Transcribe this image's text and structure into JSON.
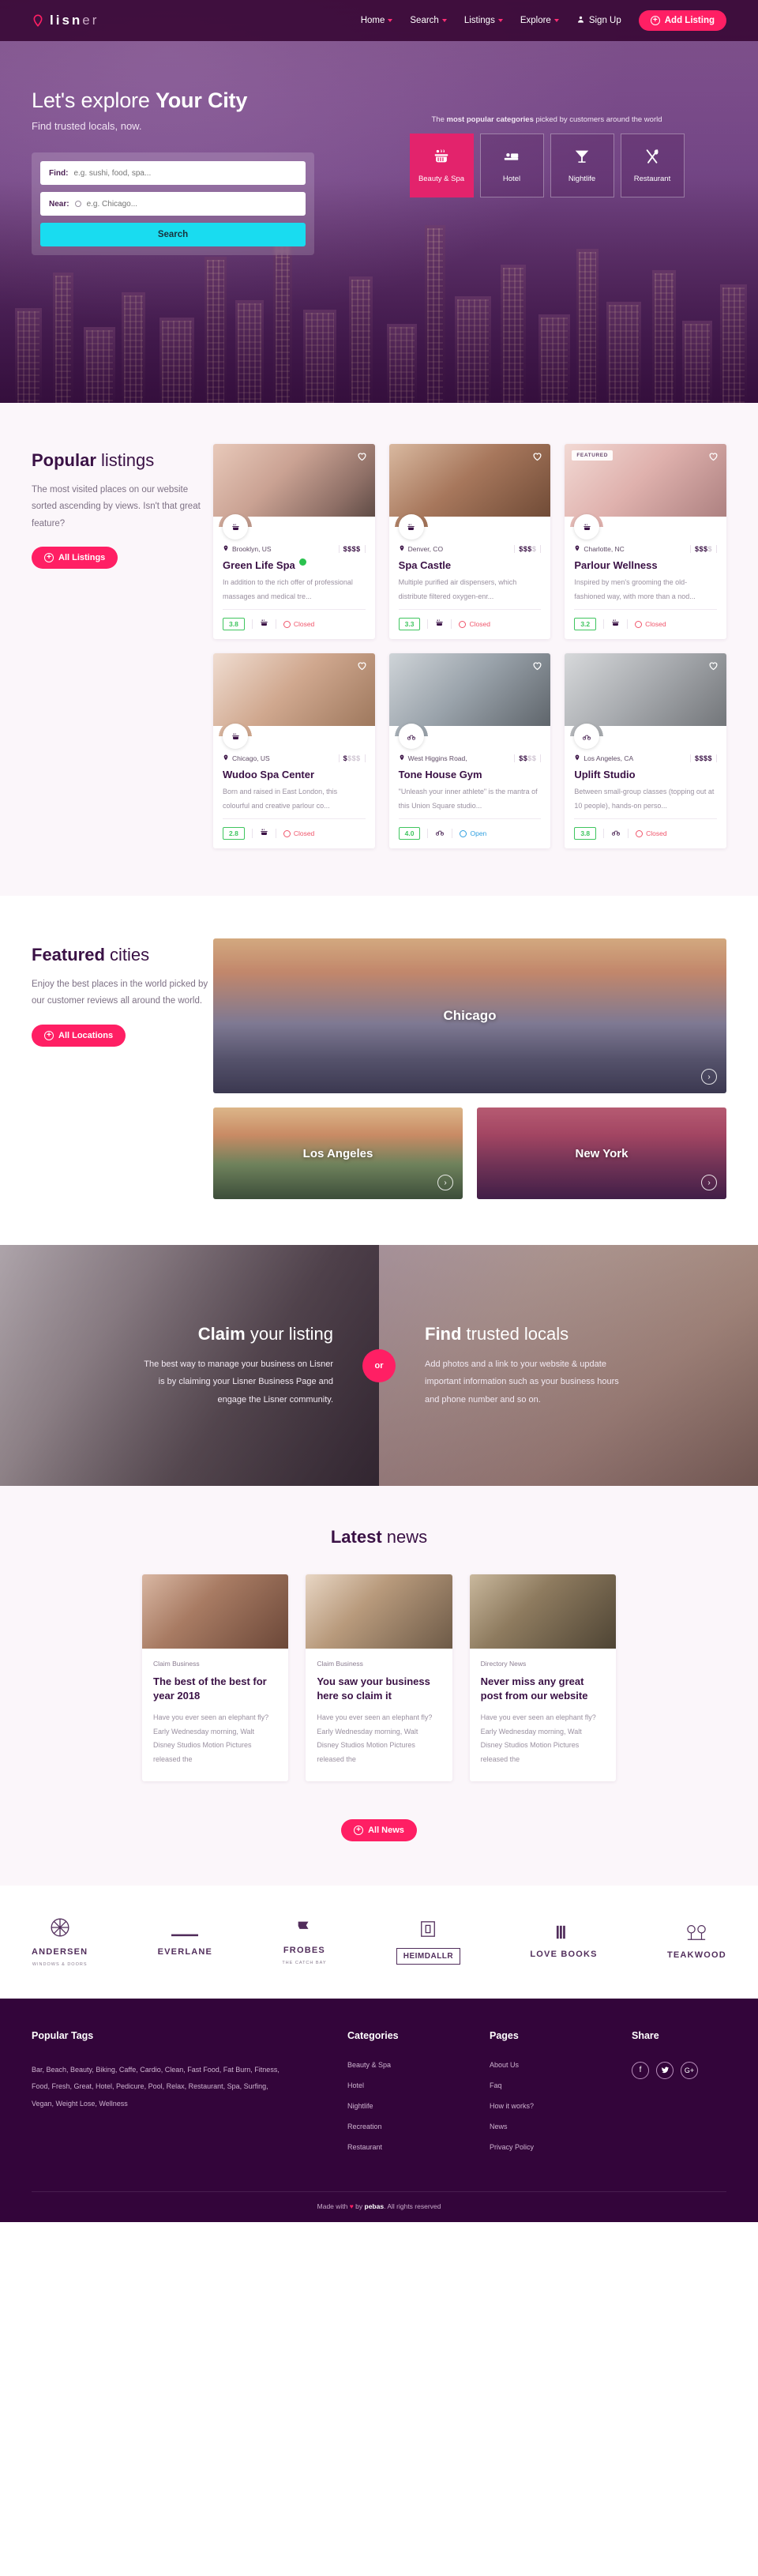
{
  "brand": {
    "name_bold": "lisn",
    "name_light": "er",
    "mark": "location-drop-icon"
  },
  "nav": {
    "items": [
      {
        "label": "Home",
        "has_dropdown": true
      },
      {
        "label": "Search",
        "has_dropdown": true
      },
      {
        "label": "Listings",
        "has_dropdown": true
      },
      {
        "label": "Explore",
        "has_dropdown": true
      }
    ],
    "signup_label": "Sign Up",
    "add_listing_label": "Add Listing"
  },
  "hero": {
    "title_light": "Let's explore ",
    "title_bold": "Your City",
    "subtitle": "Find trusted locals, now.",
    "find_label": "Find:",
    "find_placeholder": "e.g. sushi, food, spa...",
    "near_label": "Near:",
    "near_placeholder": "e.g. Chicago...",
    "search_button": "Search",
    "categories_caption_pre": "The ",
    "categories_caption_bold": "most popular categories",
    "categories_caption_post": " picked by customers around the world",
    "categories": [
      {
        "label": "Beauty & Spa",
        "icon": "spa-icon",
        "active": true
      },
      {
        "label": "Hotel",
        "icon": "bed-icon",
        "active": false
      },
      {
        "label": "Nightlife",
        "icon": "cocktail-icon",
        "active": false
      },
      {
        "label": "Restaurant",
        "icon": "fork-spoon-icon",
        "active": false
      }
    ]
  },
  "popular": {
    "title_bold": "Popular",
    "title_light": " listings",
    "description": "The most visited places on our website sorted ascending by views. Isn't that great feature?",
    "button": "All Listings",
    "listings": [
      {
        "location": "Brooklyn, US",
        "price": "$$$$",
        "price_filled": 4,
        "name": "Green Life Spa",
        "verified": true,
        "featured": false,
        "text": "In addition to the rich offer of professional massages and medical tre...",
        "rating": "3.8",
        "status": "Closed",
        "open": false,
        "type_icon": "spa-icon"
      },
      {
        "location": "Denver, CO",
        "price": "$$$$",
        "price_filled": 3,
        "name": "Spa Castle",
        "verified": false,
        "featured": false,
        "text": "Multiple purified air dispensers, which distribute filtered oxygen-enr...",
        "rating": "3.3",
        "status": "Closed",
        "open": false,
        "type_icon": "spa-icon"
      },
      {
        "location": "Charlotte, NC",
        "price": "$$$$",
        "price_filled": 3,
        "name": "Parlour Wellness",
        "verified": false,
        "featured": true,
        "text": "Inspired by men's grooming the old-fashioned way, with more than a nod...",
        "rating": "3.2",
        "status": "Closed",
        "open": false,
        "type_icon": "spa-icon"
      },
      {
        "location": "Chicago, US",
        "price": "$$$$",
        "price_filled": 1,
        "name": "Wudoo Spa Center",
        "verified": false,
        "featured": false,
        "text": "Born and raised in East London, this colourful and creative parlour co...",
        "rating": "2.8",
        "status": "Closed",
        "open": false,
        "type_icon": "spa-icon"
      },
      {
        "location": "West Higgins Road,",
        "price": "$$$$",
        "price_filled": 2,
        "name": "Tone House Gym",
        "verified": false,
        "featured": false,
        "text": "\"Unleash your inner athlete\" is the mantra of this Union Square studio...",
        "rating": "4.0",
        "status": "Open",
        "open": true,
        "type_icon": "bike-icon"
      },
      {
        "location": "Los Angeles, CA",
        "price": "$$$$",
        "price_filled": 4,
        "name": "Uplift Studio",
        "verified": false,
        "featured": false,
        "text": "Between small-group classes (topping out at 10 people), hands-on perso...",
        "rating": "3.8",
        "status": "Closed",
        "open": false,
        "type_icon": "bike-icon"
      }
    ]
  },
  "cities": {
    "title_bold": "Featured",
    "title_light": " cities",
    "description": "Enjoy the best places in the world picked by our customer reviews all around the world.",
    "button": "All Locations",
    "big": {
      "name": "Chicago",
      "arrow": "arrow-right-icon"
    },
    "small": [
      {
        "name": "Los Angeles",
        "arrow": "arrow-right-icon"
      },
      {
        "name": "New York",
        "arrow": "arrow-right-icon"
      }
    ]
  },
  "claim": {
    "or_label": "or",
    "left": {
      "title_bold": "Claim",
      "title_light": " your listing",
      "text": "The best way to manage your business on Lisner is by claiming your Lisner Business Page and engage the Lisner community."
    },
    "right": {
      "title_bold": "Find",
      "title_light": " trusted locals",
      "text": "Add photos and a link to your website & update important information such as your business hours and phone number and so on."
    }
  },
  "news": {
    "title_bold": "Latest",
    "title_light": " news",
    "button": "All News",
    "posts": [
      {
        "category": "Claim Business",
        "title": "The best of the best for year 2018",
        "excerpt": "Have you ever seen an elephant fly?  Early Wednesday morning, Walt Disney Studios Motion Pictures released the"
      },
      {
        "category": "Claim Business",
        "title": "You saw your business here so claim it",
        "excerpt": "Have you ever seen an elephant fly?  Early Wednesday morning, Walt Disney Studios Motion Pictures released the"
      },
      {
        "category": "Directory News",
        "title": "Never miss any great post from our website",
        "excerpt": "Have you ever seen an elephant fly?  Early Wednesday morning, Walt Disney Studios Motion Pictures released the"
      }
    ]
  },
  "partners": [
    {
      "name": "ANDERSEN",
      "sub": "WINDOWS & DOORS",
      "icon": "andersen-logo"
    },
    {
      "name": "EVERLANE",
      "sub": "",
      "icon": "everlane-logo"
    },
    {
      "name": "FROBES",
      "sub": "THE CATCH BAY",
      "icon": "frobes-logo"
    },
    {
      "name": "HEIMDALLR",
      "sub": "",
      "icon": "heimdallr-logo"
    },
    {
      "name": "LOVE BOOKS",
      "sub": "",
      "icon": "lovebooks-logo"
    },
    {
      "name": "TEAKWOOD",
      "sub": "",
      "icon": "teakwood-logo"
    }
  ],
  "footer": {
    "tags_heading": "Popular Tags",
    "tags_text": "Bar, Beach, Beauty, Biking, Caffe, Cardio, Clean, Fast Food, Fat Burn, Fitness, Food, Fresh, Great, Hotel, Pedicure, Pool, Relax, Restaurant, Spa, Surfing, Vegan, Weight Lose, Wellness",
    "categories_heading": "Categories",
    "categories": [
      "Beauty & Spa",
      "Hotel",
      "Nightlife",
      "Recreation",
      "Restaurant"
    ],
    "pages_heading": "Pages",
    "pages": [
      "About Us",
      "Faq",
      "How it works?",
      "News",
      "Privacy Policy"
    ],
    "share_heading": "Share",
    "socials": [
      {
        "name": "facebook-icon",
        "glyph": "f"
      },
      {
        "name": "twitter-icon",
        "glyph": "t"
      },
      {
        "name": "google-plus-icon",
        "glyph": "G+"
      }
    ],
    "copyright_pre": "Made with ",
    "copyright_heart": "♥",
    "copyright_by": " by ",
    "copyright_brand": "pebas",
    "copyright_post": ". All rights reserved"
  },
  "colors": {
    "accent": "#ff1f64",
    "dark": "#33053a",
    "cyan": "#19dcf0",
    "green": "#3fc55f",
    "red": "#f0556b",
    "blue": "#2f9fe0"
  }
}
